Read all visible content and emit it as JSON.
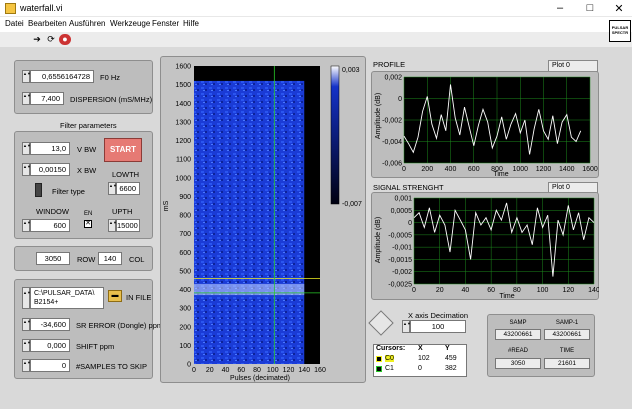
{
  "window": {
    "title": "waterfall.vi"
  },
  "menu": [
    "Datei",
    "Bearbeiten",
    "Ausführen",
    "Werkzeuge",
    "Fenster",
    "Hilfe"
  ],
  "vi_icon_text": "PULSAR SPECTR",
  "top_controls": {
    "f0": {
      "value": "0,6556164728",
      "label": "F0 Hz"
    },
    "dispersion": {
      "value": "7,400",
      "label": "DISPERSION (mS/MHz)"
    }
  },
  "filter": {
    "title": "Filter parameters",
    "v_bw": {
      "value": "13,0",
      "label": "V BW"
    },
    "x_bw": {
      "value": "0,00150",
      "label": "X BW"
    },
    "start_label": "START",
    "lowth": {
      "label": "LOWTH",
      "value": "6600"
    },
    "filter_type_label": "Filter type",
    "window": {
      "label": "WINDOW",
      "value": "600"
    },
    "en_label": "EN",
    "upth": {
      "label": "UPTH",
      "value": "15000"
    }
  },
  "row_col": {
    "row_value": "3050",
    "row_label": "ROW",
    "col_value": "140",
    "col_label": "COL"
  },
  "file_section": {
    "path_line1": "C:\\PULSAR_DATA\\",
    "path_line2": "B2154+",
    "in_file_label": "IN FILE",
    "sr_error": {
      "value": "-34,600",
      "label": "SR ERROR (Dongle) ppm"
    },
    "shift": {
      "value": "0,000",
      "label": "SHIFT ppm"
    },
    "samples_to_skip": {
      "value": "0",
      "label": "#SAMPLES TO SKIP"
    }
  },
  "waterfall": {
    "y_label": "mS",
    "x_label": "Pulses (decimated)",
    "x_ticks": [
      "0",
      "20",
      "40",
      "60",
      "80",
      "100",
      "120",
      "140",
      "160"
    ],
    "y_ticks": [
      "0",
      "100",
      "200",
      "300",
      "400",
      "500",
      "600",
      "700",
      "800",
      "900",
      "1000",
      "1100",
      "1200",
      "1300",
      "1400",
      "1500",
      "1600"
    ],
    "colorbar_max": "0,003",
    "colorbar_min": "-0,007"
  },
  "profile": {
    "title": "PROFILE",
    "legend": "Plot 0",
    "y_label": "Amplitude (dB)",
    "x_label": "Time",
    "x_ticks": [
      "0",
      "100",
      "200",
      "300",
      "400",
      "500",
      "600",
      "700",
      "800",
      "900",
      "1000",
      "1100",
      "1200",
      "1300",
      "1400",
      "1500",
      "1600"
    ],
    "y_ticks": [
      "0,002",
      "0",
      "-0,002",
      "-0,004",
      "-0,006"
    ]
  },
  "signal": {
    "title": "SIGNAL STRENGHT",
    "legend": "Plot 0",
    "y_label": "Amplitude (dB)",
    "x_label": "Time",
    "x_ticks": [
      "0",
      "10",
      "20",
      "30",
      "40",
      "50",
      "60",
      "70",
      "80",
      "90",
      "100",
      "110",
      "120",
      "130",
      "140"
    ],
    "y_ticks": [
      "0,001",
      "0,0005",
      "0",
      "-0,0005",
      "-0,001",
      "-0,0015",
      "-0,002",
      "-0,0025"
    ]
  },
  "decimation": {
    "label": "X axis Decimation",
    "value": "100"
  },
  "cursors": {
    "header": [
      "Cursors:",
      "X",
      "Y"
    ],
    "rows": [
      {
        "name": "C0",
        "x": "102",
        "y": "459"
      },
      {
        "name": "C1",
        "x": "0",
        "y": "382"
      }
    ]
  },
  "right_info": {
    "samp_label": "SAMP",
    "samp_value": "43200661",
    "samp1_label": "SAMP-1",
    "samp1_value": "43200661",
    "nread_label": "#READ",
    "nread_value": "3050",
    "time_label": "TIME",
    "time_value": "21601"
  },
  "colors": {
    "waterfall_blue": "#1432c8",
    "grid_green": "#1d8a1d",
    "start_button": "#e67a74",
    "cursor_yellow": "#f0f020",
    "cursor_green": "#28c828"
  },
  "chart_data": [
    {
      "type": "heatmap",
      "title": "",
      "xlabel": "Pulses (decimated)",
      "ylabel": "mS",
      "xlim": [
        0,
        160
      ],
      "ylim": [
        0,
        1600
      ],
      "colorbar_range": [
        -0.007,
        0.003
      ],
      "cursors": [
        {
          "name": "C0",
          "x": 102,
          "y": 459
        },
        {
          "name": "C1",
          "x": 0,
          "y": 382
        }
      ]
    },
    {
      "type": "line",
      "title": "PROFILE",
      "xlabel": "Time",
      "ylabel": "Amplitude (dB)",
      "xlim": [
        0,
        1600
      ],
      "ylim": [
        -0.006,
        0.002
      ],
      "series": [
        {
          "name": "Plot 0",
          "x": [
            0,
            40,
            80,
            120,
            160,
            200,
            240,
            280,
            320,
            360,
            400,
            440,
            480,
            520,
            560,
            600,
            640,
            680,
            720,
            760,
            800,
            840,
            880,
            920,
            960,
            1000,
            1040,
            1080,
            1120,
            1160,
            1200,
            1240,
            1280,
            1320,
            1360,
            1400,
            1440,
            1480,
            1520
          ],
          "y": [
            -0.0035,
            -0.0042,
            -0.005,
            -0.0036,
            -0.0012,
            0.0002,
            -0.0024,
            -0.0037,
            -0.0015,
            -0.003,
            0.0013,
            -0.0018,
            -0.0034,
            -0.0008,
            -0.0026,
            -0.0044,
            -0.0025,
            -0.001,
            -0.0022,
            -0.0046,
            -0.0035,
            -0.0017,
            -0.0038,
            -0.0024,
            -0.0014,
            -0.0032,
            -0.002,
            -0.0052,
            -0.0028,
            -0.001,
            -0.003,
            -0.0038,
            -0.0016,
            -0.0042,
            -0.0022,
            -0.0015,
            -0.0036,
            -0.004,
            -0.003
          ]
        }
      ]
    },
    {
      "type": "line",
      "title": "SIGNAL STRENGHT",
      "xlabel": "Time",
      "ylabel": "Amplitude (dB)",
      "xlim": [
        0,
        140
      ],
      "ylim": [
        -0.0025,
        0.001
      ],
      "series": [
        {
          "name": "Plot 0",
          "x": [
            0,
            4,
            8,
            12,
            16,
            20,
            24,
            28,
            32,
            36,
            40,
            44,
            48,
            52,
            56,
            60,
            64,
            68,
            72,
            76,
            80,
            84,
            88,
            92,
            96,
            100,
            104,
            108,
            112,
            116,
            120,
            124,
            128,
            132,
            136,
            140
          ],
          "y": [
            0.0002,
            0.0004,
            -0.0002,
            0.0006,
            -0.0004,
            0.0003,
            -0.0001,
            -0.0012,
            0.0005,
            0.0001,
            -0.0003,
            -0.0015,
            0.0004,
            -0.0001,
            0.0002,
            -0.0003,
            0.0005,
            0.0001,
            0.0008,
            -0.0004,
            0.0002,
            -0.0004,
            -0.0001,
            -0.0009,
            0.0006,
            -0.0002,
            0.0003,
            -0.0022,
            0.0001,
            -0.0005,
            0.0007,
            -0.0003,
            0.0004,
            -0.0007,
            0.0002,
            0.0
          ]
        }
      ]
    }
  ]
}
